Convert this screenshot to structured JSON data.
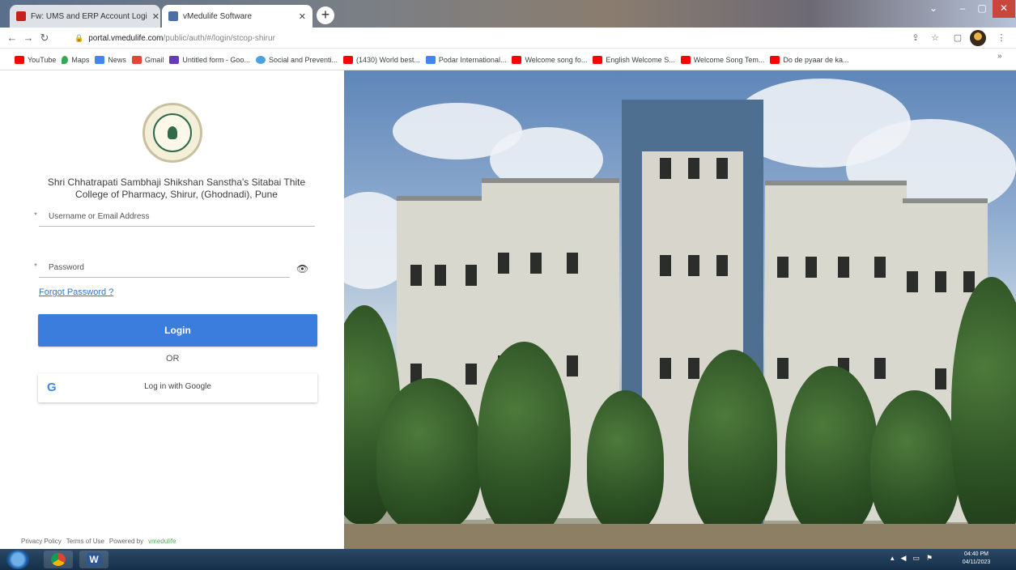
{
  "browser": {
    "tabs": [
      {
        "label": "Fw: UMS and ERP Account Logi",
        "favicon_color": "#c5221f"
      },
      {
        "label": "vMedulife Software",
        "favicon_color": "#4a6fa5"
      }
    ],
    "new_tab_label": "+",
    "url_host": "portal.vmedulife.com",
    "url_path": "/public/auth/#/login/stcop-shirur",
    "bookmarks": [
      {
        "label": "YouTube",
        "color": "#ff0000"
      },
      {
        "label": "Maps",
        "color": "#34a853"
      },
      {
        "label": "News",
        "color": "#4285f4"
      },
      {
        "label": "Gmail",
        "color": "#ea4335"
      },
      {
        "label": "Untitled form - Goo...",
        "color": "#673ab7"
      },
      {
        "label": "Social and Preventi...",
        "color": "#4aa3df"
      },
      {
        "label": "(1430) World best...",
        "color": "#ff0000"
      },
      {
        "label": "Podar International...",
        "color": "#4285f4"
      },
      {
        "label": "Welcome song fo...",
        "color": "#ff0000"
      },
      {
        "label": "English Welcome S...",
        "color": "#ff0000"
      },
      {
        "label": "Welcome Song Tem...",
        "color": "#ff0000"
      },
      {
        "label": "Do de pyaar de ka...",
        "color": "#ff0000"
      }
    ]
  },
  "login": {
    "college_name": "Shri Chhatrapati Sambhaji Shikshan Sanstha's Sitabai Thite College of Pharmacy, Shirur, (Ghodnadi), Pune",
    "username_placeholder": "Username or Email Address",
    "password_placeholder": "Password",
    "required_mark": "*",
    "forgot_password": "Forgot Password ?",
    "login_button": "Login",
    "or_text": "OR",
    "google_button": "Log in with Google",
    "google_glyph": "G"
  },
  "footer": {
    "privacy": "Privacy Policy",
    "terms": "Terms of Use",
    "powered_by": "Powered by",
    "brand": "vmedulife"
  },
  "taskbar": {
    "time": "04:40 PM",
    "date": "04/11/2023"
  }
}
